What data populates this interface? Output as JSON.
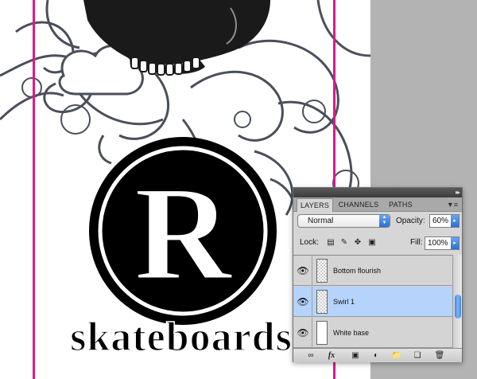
{
  "colors": {
    "guide": "#e0188c",
    "artwork_ink": "#1a1a1a",
    "flourish": "#4a4f5a",
    "panel_bg": "#d6d6d6",
    "selection": "#b5d3fb",
    "accent_blue": "#2a6fd6"
  },
  "canvas": {
    "logo_letter": "R",
    "logo_word": "skateboards"
  },
  "layers_panel": {
    "collapse_icon": "double-chevron-right-icon",
    "tabs": [
      {
        "label": "LAYERS",
        "active": true
      },
      {
        "label": "CHANNELS",
        "active": false
      },
      {
        "label": "PATHS",
        "active": false
      }
    ],
    "menu_icon": "panel-menu-icon",
    "blend_mode": "Normal",
    "opacity_label": "Opacity:",
    "opacity_value": "60%",
    "lock_label": "Lock:",
    "lock_icons": [
      "lock-transparent-icon",
      "lock-paint-icon",
      "lock-move-icon",
      "lock-all-icon"
    ],
    "fill_label": "Fill:",
    "fill_value": "100%",
    "layers": [
      {
        "name": "Bottom flourish",
        "visible": true,
        "selected": false,
        "thumb": "transparent"
      },
      {
        "name": "Swirl 1",
        "visible": true,
        "selected": true,
        "thumb": "transparent"
      },
      {
        "name": "White base",
        "visible": true,
        "selected": false,
        "thumb": "white"
      }
    ],
    "bottom_tools": [
      "link-layers-icon",
      "layer-style-icon",
      "add-mask-icon",
      "adjustment-layer-icon",
      "new-group-icon",
      "new-layer-icon",
      "delete-layer-icon"
    ]
  }
}
